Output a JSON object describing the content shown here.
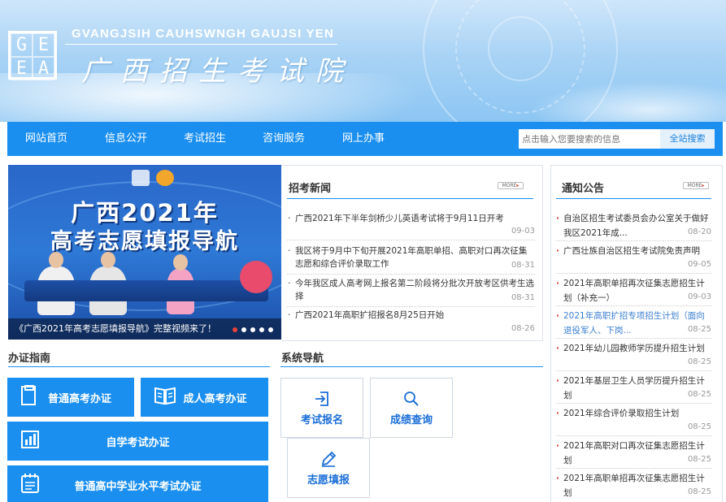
{
  "header": {
    "site_name_en": "GVANGJSIH CAUHSWNGH GAUJSI YEN",
    "site_name_cn": "广西招生考试院",
    "logo_letters": [
      "G",
      "E",
      "E",
      "A"
    ]
  },
  "nav": {
    "items": [
      "网站首页",
      "信息公开",
      "考试招生",
      "咨询服务",
      "网上办事"
    ],
    "search_placeholder": "点击输入您要搜索的信息",
    "search_button": "全站搜索"
  },
  "banner": {
    "headline_1": "广西2021年",
    "headline_2": "高考志愿填报导航",
    "caption": "《广西2021年高考志愿填报导航》完整视频来了！",
    "slide_count": 5,
    "active_slide": 1
  },
  "news": {
    "title": "招考新闻",
    "more_label": "MORE",
    "items": [
      {
        "text": "广西2021年下半年剑桥少儿英语考试将于9月11日开考",
        "date": "09-03"
      },
      {
        "text": "我区将于9月中下旬开展2021年高职单招、高职对口再次征集志愿和综合评价录取工作",
        "date": "08-31"
      },
      {
        "text": "今年我区成人高考网上报名第二阶段将分批次开放考区供考生选择",
        "date": "08-31"
      },
      {
        "text": "广西2021年高职扩招报名8月25日开始",
        "date": "08-26"
      }
    ]
  },
  "notice": {
    "title": "通知公告",
    "more_label": "MORE",
    "items": [
      {
        "text": "自治区招生考试委员会办公室关于做好我区2021年成...",
        "date": "08-20"
      },
      {
        "text": "广西壮族自治区招生考试院免责声明",
        "date": "09-05"
      },
      {
        "text": "2021年高职单招再次征集志愿招生计划（补充一）",
        "date": "09-03"
      },
      {
        "text": "2021年高职扩招专项招生计划（面向退役军人、下岗...",
        "date": "08-25"
      },
      {
        "text": "2021年幼儿园教师学历提升招生计划",
        "date": "08-25"
      },
      {
        "text": "2021年基层卫生人员学历提升招生计划",
        "date": "08-25"
      },
      {
        "text": "2021年综合评价录取招生计划",
        "date": "08-25"
      },
      {
        "text": "2021年高职对口再次征集志愿招生计划",
        "date": "08-25"
      },
      {
        "text": "2021年高职单招再次征集志愿招生计划",
        "date": "08-25"
      }
    ]
  },
  "guide": {
    "title": "办证指南",
    "buttons": [
      "普通高考办证",
      "成人高考办证",
      "自学考试办证",
      "普通高中学业水平考试办证"
    ]
  },
  "system_nav": {
    "title": "系统导航",
    "tiles": [
      "考试报名",
      "成绩查询",
      "志愿填报"
    ]
  },
  "colors": {
    "primary": "#1a8ff0",
    "accent_red": "#d53a2a",
    "link_blue": "#3b7fd0"
  }
}
